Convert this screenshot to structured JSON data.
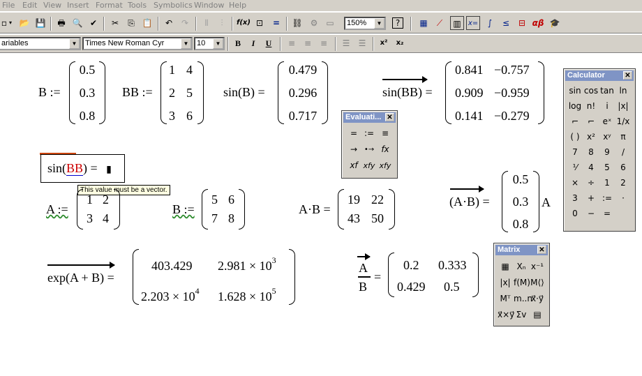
{
  "menu": [
    "File",
    "Edit",
    "View",
    "Insert",
    "Format",
    "Tools",
    "Symbolics",
    "Window",
    "Help"
  ],
  "toolbar": {
    "zoom": "150%",
    "zoom_help": "?",
    "style_combo": "ariables",
    "font_combo": "Times New Roman Cyr",
    "size_combo": "10",
    "bold": "B",
    "italic": "I",
    "underline": "U",
    "superscript": "x²",
    "subscript": "x₂",
    "insert_function": "f(x)",
    "greek": "αβ"
  },
  "worksheet": {
    "def_B": {
      "lhs": "B :=",
      "values": [
        "0.5",
        "0.3",
        "0.8"
      ]
    },
    "def_BB": {
      "lhs": "BB :=",
      "values": [
        [
          "1",
          "4"
        ],
        [
          "2",
          "5"
        ],
        [
          "3",
          "6"
        ]
      ]
    },
    "sinB": {
      "lhs": "sin(B) =",
      "values": [
        "0.479",
        "0.296",
        "0.717"
      ]
    },
    "sinBB_vec": {
      "lhs": "sin(BB) =",
      "values": [
        [
          "0.841",
          "−0.757"
        ],
        [
          "0.909",
          "−0.959"
        ],
        [
          "0.141",
          "−0.279"
        ]
      ]
    },
    "sinBB_error": {
      "prefix": "sin(",
      "arg": "BB",
      "suffix": ") =",
      "cursor": "▮"
    },
    "tooltip": "This value must be a vector.",
    "def_A": {
      "lhs": "A :=",
      "values": [
        [
          "1",
          "2"
        ],
        [
          "3",
          "4"
        ]
      ]
    },
    "def_B2": {
      "lhs": "B :=",
      "values": [
        [
          "5",
          "6"
        ],
        [
          "7",
          "8"
        ]
      ]
    },
    "AB": {
      "lhs": "A·B =",
      "values": [
        [
          "19",
          "22"
        ],
        [
          "43",
          "50"
        ]
      ]
    },
    "AB_vec": {
      "lhs": "(A·B) =",
      "values": [
        "0.5",
        "0.3",
        "0.8"
      ],
      "trailing": "A"
    },
    "exp_vec": {
      "lhs": "exp(A + B) =",
      "values": [
        [
          {
            "mant": "403.429",
            "exp": ""
          },
          {
            "mant": "2.981 × 10",
            "exp": "3"
          }
        ],
        [
          {
            "mant": "2.203 × 10",
            "exp": "4"
          },
          {
            "mant": "1.628 × 10",
            "exp": "5"
          }
        ]
      ]
    },
    "div_vec": {
      "num": "A",
      "den": "B",
      "eq": "=",
      "values": [
        [
          "0.2",
          "0.333"
        ],
        [
          "0.429",
          "0.5"
        ]
      ]
    }
  },
  "evaluation_palette": {
    "title": "Evaluati...",
    "buttons": [
      "=",
      ":=",
      "≡",
      "→",
      "•→",
      "fx",
      "xf",
      "xfy",
      "xfy"
    ]
  },
  "calculator_palette": {
    "title": "Calculator",
    "buttons": [
      "sin",
      "cos",
      "tan",
      "ln",
      "log",
      "n!",
      "i",
      "|x|",
      "⌐",
      "⌐",
      "eˣ",
      "1/x",
      "( )",
      "x²",
      "xʸ",
      "π",
      "7",
      "8",
      "9",
      "/",
      "⅟",
      "4",
      "5",
      "6",
      "×",
      "÷",
      "1",
      "2",
      "3",
      "+",
      ":=",
      "·",
      "0",
      "−",
      "="
    ]
  },
  "matrix_palette": {
    "title": "Matrix",
    "buttons": [
      "▦",
      "Xₙ",
      "x⁻¹",
      "|x|",
      "f(M)",
      "M⟨⟩",
      "Mᵀ",
      "m..n",
      "x⃗·y⃗",
      "x⃗×y⃗",
      "Σv",
      "▤"
    ]
  },
  "colors": {
    "palette_title": "#7f94c5",
    "error_red": "#cc0000",
    "tooltip_bg": "#ffffe1",
    "chrome": "#d4d0c8"
  }
}
